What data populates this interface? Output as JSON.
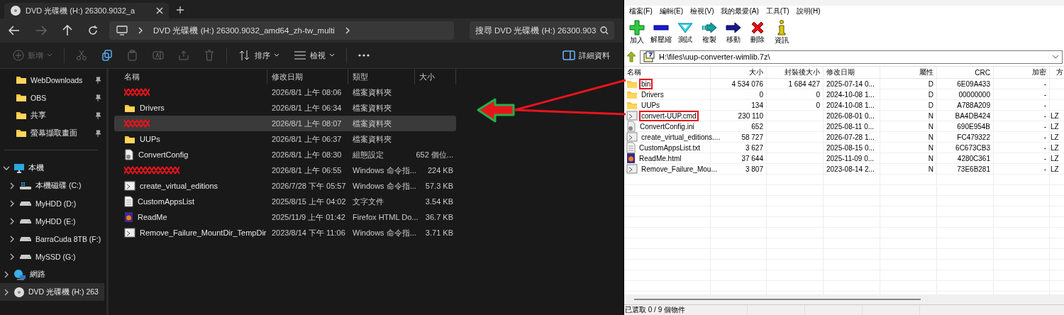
{
  "explorer": {
    "tab_title": "DVD 光碟機 (H:) 26300.9032_a",
    "address": "DVD 光碟機 (H:) 26300.9032_amd64_zh-tw_multi",
    "search_placeholder": "搜尋 DVD 光碟機 (H:) 26300.903",
    "toolbar": [
      {
        "label": "新增",
        "dropdown": true,
        "disabled": true
      },
      {
        "disabled": true
      },
      {
        "disabled": false
      },
      {
        "disabled": true
      },
      {
        "disabled": true
      },
      {
        "disabled": true
      },
      {
        "disabled": true
      },
      {
        "label": "排序",
        "dropdown": true,
        "disabled": false
      },
      {
        "label": "檢視",
        "dropdown": true,
        "disabled": false
      },
      {
        "disabled": false
      }
    ],
    "details_label": "詳細資料",
    "quick_access": [
      {
        "label": "WebDownloads",
        "pinned": true
      },
      {
        "label": "OBS",
        "pinned": true
      },
      {
        "label": "共享",
        "pinned": true
      },
      {
        "label": "螢幕擷取畫面",
        "pinned": true
      }
    ],
    "tree": [
      {
        "label": "本機",
        "expanded": true,
        "selected": false,
        "children": [
          {
            "label": "本機磁碟 (C:)",
            "expanded": false,
            "selected": false
          },
          {
            "label": "MyHDD (D:)",
            "expanded": false,
            "selected": false
          },
          {
            "label": "MyHDD (E:)",
            "expanded": false,
            "selected": false
          },
          {
            "label": "BarraCuda 8TB (F:)",
            "expanded": false,
            "selected": false
          },
          {
            "label": "MySSD (G:)",
            "expanded": false,
            "selected": false
          }
        ]
      },
      {
        "label": "網路",
        "expanded": false,
        "selected": false
      },
      {
        "label": "DVD 光碟機 (H:) 263",
        "expanded": false,
        "selected": true
      }
    ],
    "columns": [
      "名稱",
      "修改日期",
      "類型",
      "大小"
    ],
    "rows": [
      {
        "kind": "redacted",
        "date": "2026/8/1 上午 08:06",
        "type": "檔案資料夾",
        "selected": false
      },
      {
        "kind": "folder",
        "name": "Drivers",
        "date": "2026/8/1 上午 06:34",
        "type": "檔案資料夾",
        "selected": false
      },
      {
        "kind": "redacted",
        "date": "2026/8/1 上午 08:07",
        "type": "檔案資料夾",
        "selected": true
      },
      {
        "kind": "folder",
        "name": "UUPs",
        "date": "2026/8/1 上午 06:37",
        "type": "檔案資料夾",
        "selected": false
      },
      {
        "kind": "config",
        "name": "ConvertConfig",
        "date": "2026/8/1 上午 08:30",
        "type": "組態設定",
        "size": "652 個位...",
        "selected": false
      },
      {
        "kind": "redacted",
        "date": "2026/8/1 上午 06:55",
        "type": "Windows 命令指...",
        "size": "224 KB",
        "selected": false
      },
      {
        "kind": "cmd",
        "name": "create_virtual_editions",
        "date": "2026/7/28 下午 05:57",
        "type": "Windows 命令指...",
        "size": "57.3 KB",
        "selected": false
      },
      {
        "kind": "text",
        "name": "CustomAppsList",
        "date": "2025/8/15 上午 04:02",
        "type": "文字文件",
        "size": "3.54 KB",
        "selected": false
      },
      {
        "kind": "html",
        "name": "ReadMe",
        "date": "2025/11/9 上午 01:42",
        "type": "Firefox HTML Do...",
        "size": "36.7 KB",
        "selected": false
      },
      {
        "kind": "cmd",
        "name": "Remove_Failure_MountDir_TempDir",
        "date": "2023/8/14 下午 11:06",
        "type": "Windows 命令指...",
        "size": "3.71 KB",
        "selected": false
      }
    ]
  },
  "sevenzip": {
    "menu": [
      "檔案(F)",
      "編輯(E)",
      "檢視(V)",
      "我的最愛(A)",
      "工具(T)",
      "說明(H)"
    ],
    "toolbar": [
      "加入",
      "解壓縮",
      "測試",
      "複製",
      "移動",
      "刪除",
      "資訊"
    ],
    "path": "H:\\files\\uup-converter-wimlib.7z\\",
    "columns": [
      "名稱",
      "大小",
      "封裝後大小",
      "修改日期",
      "屬性",
      "CRC",
      "加密",
      "方"
    ],
    "rows": [
      {
        "kind": "folder",
        "name": "bin",
        "size": "4 534 076",
        "packed": "1 684 427",
        "date": "2025-07-14 0...",
        "attr": "D",
        "crc": "6E09A433",
        "encrypted": "-",
        "highlighted": true
      },
      {
        "kind": "folder",
        "name": "Drivers",
        "size": "0",
        "packed": "0",
        "date": "2024-10-08 1...",
        "attr": "D",
        "crc": "00000000",
        "encrypted": "-",
        "highlighted": false
      },
      {
        "kind": "folder",
        "name": "UUPs",
        "size": "134",
        "packed": "0",
        "date": "2024-10-08 1...",
        "attr": "D",
        "crc": "A788A209",
        "encrypted": "-",
        "highlighted": false
      },
      {
        "kind": "cmd",
        "name": "convert-UUP.cmd",
        "size": "230 110",
        "date": "2026-08-01 0...",
        "attr": "N",
        "crc": "BA4DB424",
        "encrypted": "-",
        "method": "LZ",
        "highlighted": true
      },
      {
        "kind": "config",
        "name": "ConvertConfig.ini",
        "size": "652",
        "date": "2025-08-11 0...",
        "attr": "N",
        "crc": "690E954B",
        "encrypted": "-",
        "method": "LZ",
        "highlighted": false
      },
      {
        "kind": "cmd",
        "name": "create_virtual_editions....",
        "size": "58 727",
        "date": "2026-07-28 1...",
        "attr": "N",
        "crc": "FC479322",
        "encrypted": "-",
        "method": "LZ",
        "highlighted": false
      },
      {
        "kind": "text",
        "name": "CustomAppsList.txt",
        "size": "3 627",
        "date": "2025-08-15 0...",
        "attr": "N",
        "crc": "6C673CB3",
        "encrypted": "-",
        "method": "LZ",
        "highlighted": false
      },
      {
        "kind": "html",
        "name": "ReadMe.html",
        "size": "37 644",
        "date": "2025-11-09 0...",
        "attr": "N",
        "crc": "4280C361",
        "encrypted": "-",
        "method": "LZ",
        "highlighted": false
      },
      {
        "kind": "cmd",
        "name": "Remove_Failure_Mou...",
        "size": "3 807",
        "date": "2023-08-14 2...",
        "attr": "N",
        "crc": "73E6B281",
        "encrypted": "-",
        "method": "LZ",
        "highlighted": false
      }
    ],
    "status": "已選取 0 / 9 個物件"
  }
}
